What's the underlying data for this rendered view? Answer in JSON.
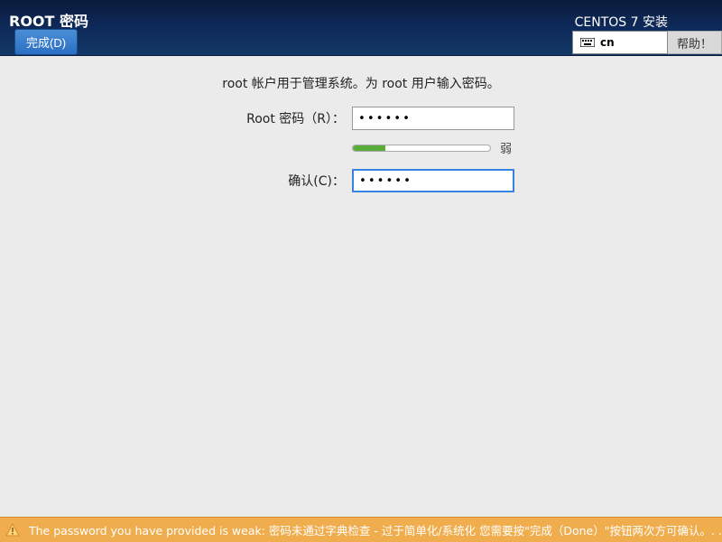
{
  "header": {
    "title": "ROOT 密码",
    "done_label": "完成(D)",
    "installer_title": "CENTOS 7 安装",
    "keyboard_layout": "cn",
    "help_label": "帮助！"
  },
  "form": {
    "instruction": "root 帐户用于管理系统。为 root 用户输入密码。",
    "password_label": "Root 密码（R）：",
    "password_value": "••••••",
    "confirm_label": "确认(C)：",
    "confirm_value": "••••••",
    "strength_label": "弱"
  },
  "warning": {
    "text": "The password you have provided is weak: 密码未通过字典检查 - 过于简单化/系统化 您需要按\"完成（Done）\"按钮两次方可确认。. ."
  }
}
